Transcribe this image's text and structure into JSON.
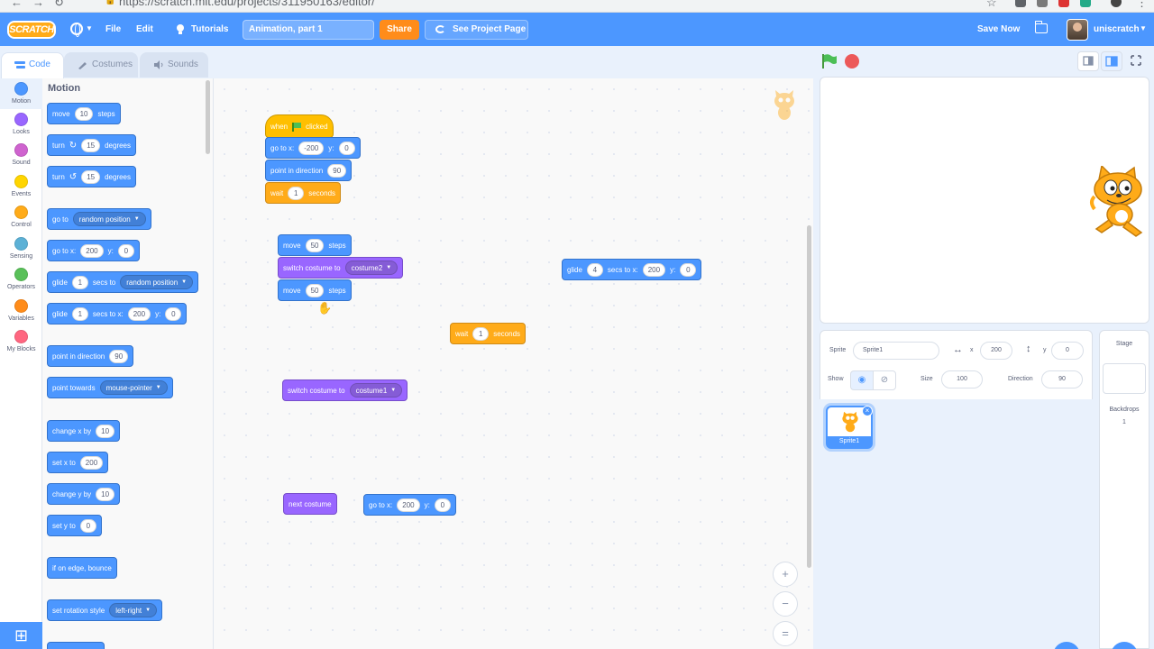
{
  "browser": {
    "url": "https://scratch.mit.edu/projects/311950163/editor/"
  },
  "menubar": {
    "logo": "SCRATCH",
    "file": "File",
    "edit": "Edit",
    "tutorials": "Tutorials",
    "project_title": "Animation, part 1",
    "share": "Share",
    "see_project_page": "See Project Page",
    "save_now": "Save Now",
    "username": "uniscratch"
  },
  "tabs": {
    "code": "Code",
    "costumes": "Costumes",
    "sounds": "Sounds"
  },
  "categories": [
    {
      "label": "Motion",
      "color": "#4c97ff"
    },
    {
      "label": "Looks",
      "color": "#9966ff"
    },
    {
      "label": "Sound",
      "color": "#cf63cf"
    },
    {
      "label": "Events",
      "color": "#ffd500"
    },
    {
      "label": "Control",
      "color": "#ffab19"
    },
    {
      "label": "Sensing",
      "color": "#5cb1d6"
    },
    {
      "label": "Operators",
      "color": "#59c059"
    },
    {
      "label": "Variables",
      "color": "#ff8c1a"
    },
    {
      "label": "My Blocks",
      "color": "#ff6680"
    }
  ],
  "palette": {
    "title": "Motion",
    "move": {
      "a": "move",
      "v": "10",
      "b": "steps"
    },
    "turn_right": {
      "a": "turn",
      "v": "15",
      "b": "degrees"
    },
    "turn_left": {
      "a": "turn",
      "v": "15",
      "b": "degrees"
    },
    "go_to": {
      "a": "go to",
      "dd": "random position"
    },
    "go_to_xy": {
      "a": "go to x:",
      "x": "200",
      "b": "y:",
      "y": "0"
    },
    "glide_to": {
      "a": "glide",
      "v": "1",
      "b": "secs to",
      "dd": "random position"
    },
    "glide_xy": {
      "a": "glide",
      "v": "1",
      "b": "secs to x:",
      "x": "200",
      "c": "y:",
      "y": "0"
    },
    "point_dir": {
      "a": "point in direction",
      "v": "90"
    },
    "point_towards": {
      "a": "point towards",
      "dd": "mouse-pointer"
    },
    "change_x": {
      "a": "change x by",
      "v": "10"
    },
    "set_x": {
      "a": "set x to",
      "v": "200"
    },
    "change_y": {
      "a": "change y by",
      "v": "10"
    },
    "set_y": {
      "a": "set y to",
      "v": "0"
    },
    "bounce": {
      "a": "if on edge, bounce"
    },
    "rotation": {
      "a": "set rotation style",
      "dd": "left-right"
    }
  },
  "workspace": {
    "script1": {
      "when": "when",
      "clicked": "clicked",
      "goto_a": "go to x:",
      "goto_x": "-200",
      "goto_b": "y:",
      "goto_y": "0",
      "point_a": "point in direction",
      "point_v": "90",
      "wait_a": "wait",
      "wait_v": "1",
      "wait_b": "seconds"
    },
    "script2": {
      "move1_a": "move",
      "move1_v": "50",
      "move1_b": "steps",
      "switch_a": "switch costume to",
      "switch_dd": "costume2",
      "move2_a": "move",
      "move2_v": "50",
      "move2_b": "steps"
    },
    "glide": {
      "a": "glide",
      "v": "4",
      "b": "secs to x:",
      "x": "200",
      "c": "y:",
      "y": "0"
    },
    "wait": {
      "a": "wait",
      "v": "1",
      "b": "seconds"
    },
    "switch2": {
      "a": "switch costume to",
      "dd": "costume1"
    },
    "next_costume": {
      "a": "next costume"
    },
    "goto2": {
      "a": "go to x:",
      "x": "200",
      "b": "y:",
      "y": "0"
    },
    "zoom_in": "+",
    "zoom_out": "−",
    "zoom_reset": "="
  },
  "sprite_info": {
    "sprite_label": "Sprite",
    "sprite_name": "Sprite1",
    "x_label": "x",
    "x_value": "200",
    "y_label": "y",
    "y_value": "0",
    "show_label": "Show",
    "size_label": "Size",
    "size_value": "100",
    "direction_label": "Direction",
    "direction_value": "90"
  },
  "sprites": [
    {
      "name": "Sprite1"
    }
  ],
  "stage_panel": {
    "title": "Stage",
    "backdrops_label": "Backdrops",
    "backdrops_count": "1"
  }
}
